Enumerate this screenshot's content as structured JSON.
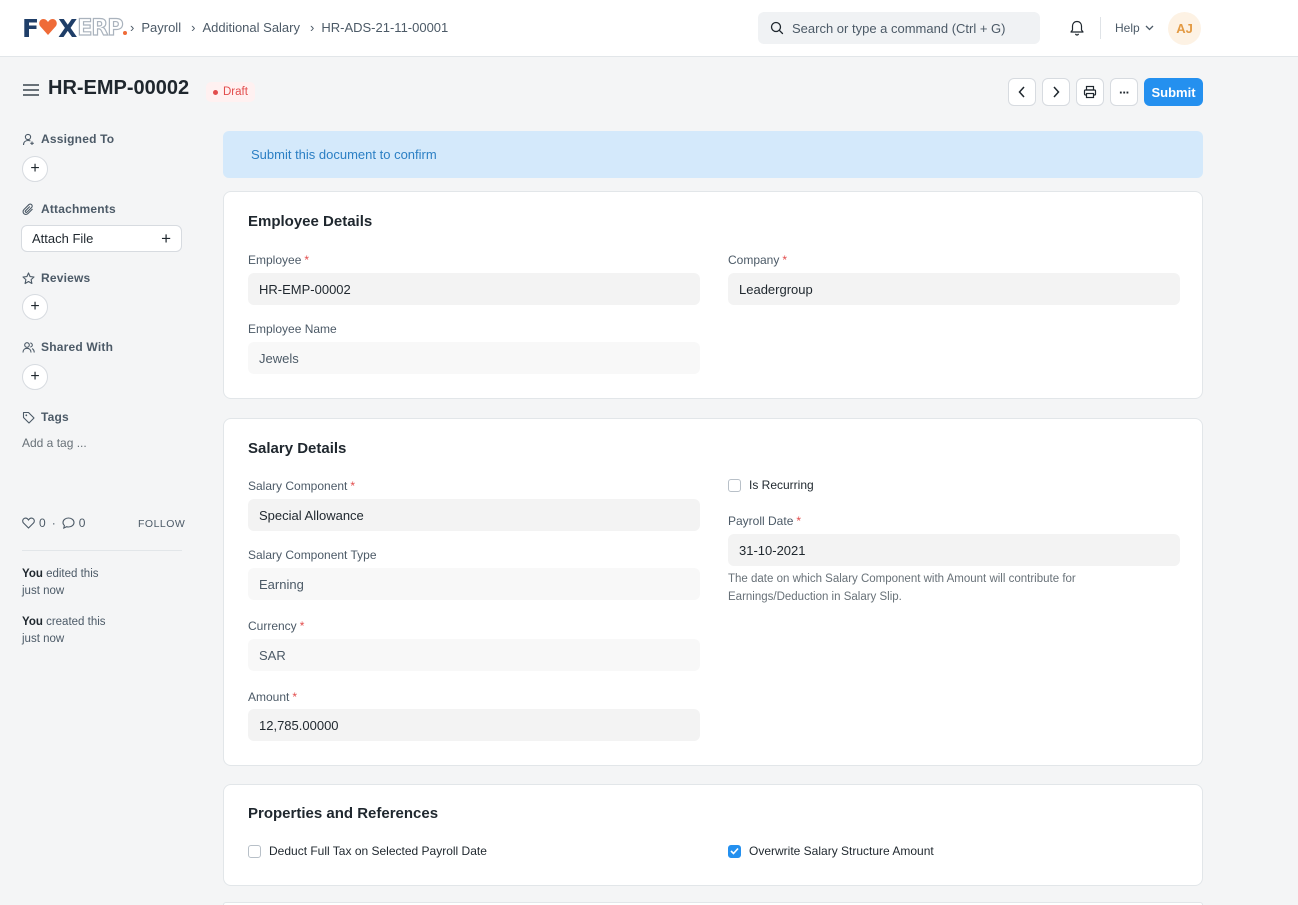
{
  "navbar": {
    "logo": {
      "f": "F",
      "o": "O",
      "x": "X",
      "erp": "ERP"
    },
    "breadcrumbs": [
      "Payroll",
      "Additional Salary",
      "HR-ADS-21-11-00001"
    ],
    "search_placeholder": "Search or type a command (Ctrl + G)",
    "help_label": "Help",
    "avatar_initials": "AJ"
  },
  "header": {
    "title": "HR-EMP-00002",
    "status": "Draft",
    "submit_label": "Submit",
    "more_label": "···"
  },
  "sidebar": {
    "assigned_to": "Assigned To",
    "attachments": "Attachments",
    "attach_file": "Attach File",
    "reviews": "Reviews",
    "shared_with": "Shared With",
    "tags": "Tags",
    "add_tag": "Add a tag ...",
    "likes": "0",
    "comments": "0",
    "follow": "FOLLOW",
    "activity": [
      {
        "who": "You",
        "action": "edited this",
        "when": "just now"
      },
      {
        "who": "You",
        "action": "created this",
        "when": "just now"
      }
    ]
  },
  "alert": "Submit this document to confirm",
  "employee_details": {
    "title": "Employee Details",
    "employee_label": "Employee",
    "employee_value": "HR-EMP-00002",
    "company_label": "Company",
    "company_value": "Leadergroup",
    "employee_name_label": "Employee Name",
    "employee_name_value": "Jewels"
  },
  "salary_details": {
    "title": "Salary Details",
    "component_label": "Salary Component",
    "component_value": "Special Allowance",
    "component_type_label": "Salary Component Type",
    "component_type_value": "Earning",
    "currency_label": "Currency",
    "currency_value": "SAR",
    "amount_label": "Amount",
    "amount_value": "12,785.00000",
    "is_recurring_label": "Is Recurring",
    "is_recurring": false,
    "payroll_date_label": "Payroll Date",
    "payroll_date_value": "31-10-2021",
    "payroll_date_desc_1": "The date on which Salary Component with Amount will contribute for",
    "payroll_date_desc_2": "Earnings/Deduction in Salary Slip."
  },
  "properties": {
    "title": "Properties and References",
    "deduct_full_tax_label": "Deduct Full Tax on Selected Payroll Date",
    "deduct_full_tax": false,
    "overwrite_label": "Overwrite Salary Structure Amount",
    "overwrite": true
  },
  "colors": {
    "primary": "#2490ef",
    "draft": "#e24c4c",
    "logo_orange": "#ef6b38",
    "logo_navy": "#1f3e68"
  }
}
